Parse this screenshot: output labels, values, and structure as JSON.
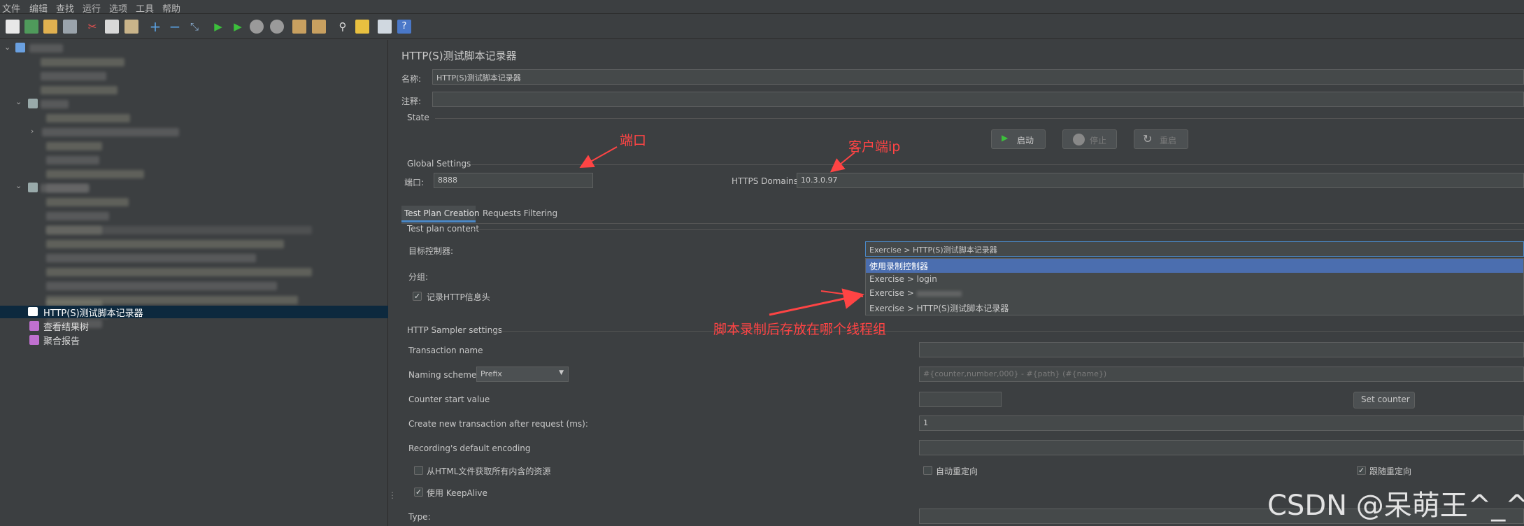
{
  "menu": [
    "文件",
    "编辑",
    "查找",
    "运行",
    "选项",
    "工具",
    "帮助"
  ],
  "toolbar_icons": [
    "new-icon",
    "templates-icon",
    "open-icon",
    "save-icon",
    "cut-icon",
    "copy-icon",
    "paste-icon",
    "expand-icon",
    "collapse-icon",
    "toggle-icon",
    "start-icon",
    "start-no-pause-icon",
    "stop-icon",
    "shutdown-icon",
    "clear-icon",
    "clear-all-icon",
    "search-icon",
    "reset-search-icon",
    "function-helper-icon",
    "help-icon"
  ],
  "tree": {
    "selected": "HTTP(S)测试脚本记录器",
    "items": [
      "查看结果树",
      "聚合报告"
    ]
  },
  "panel": {
    "title": "HTTP(S)测试脚本记录器",
    "name_label": "名称:",
    "name_value": "HTTP(S)测试脚本记录器",
    "comment_label": "注释:",
    "comment_value": "",
    "state_label": "State",
    "start_label": "启动",
    "stop_label": "停止",
    "restart_label": "重启",
    "global_label": "Global Settings",
    "port_label": "端口:",
    "port_value": "8888",
    "https_label": "HTTPS Domains:",
    "https_value": "10.3.0.97",
    "tabs": [
      "Test Plan Creation",
      "Requests Filtering"
    ],
    "test_plan_content": "Test plan content",
    "target_label": "目标控制器:",
    "target_value": "Exercise > HTTP(S)测试脚本记录器",
    "dropdown_options": [
      "使用录制控制器",
      "Exercise > login",
      "Exercise > ",
      "Exercise > HTTP(S)测试脚本记录器"
    ],
    "group_label": "分组:",
    "record_headers_label": "记录HTTP信息头",
    "sampler_settings": "HTTP Sampler settings",
    "transaction_name_label": "Transaction name",
    "transaction_name_value": "",
    "naming_scheme_label": "Naming scheme",
    "naming_scheme_value": "Prefix",
    "naming_format_placeholder": "#{counter,number,000} - #{path} (#{name})",
    "counter_start_label": "Counter start value",
    "counter_start_value": "",
    "set_counter_label": "Set counter",
    "new_transaction_label": "Create new transaction after request (ms):",
    "new_transaction_value": "1",
    "encoding_label": "Recording's default encoding",
    "encoding_value": "",
    "fetch_resources_label": "从HTML文件获取所有内含的资源",
    "auto_redirect_label": "自动重定向",
    "follow_redirect_label": "跟随重定向",
    "keepalive_label": "使用 KeepAlive",
    "type_label": "Type:"
  },
  "annotations": {
    "port": "端口",
    "client_ip": "客户端ip",
    "thread_group": "脚本录制后存放在哪个线程组"
  },
  "watermark": "CSDN @呆萌王^_^",
  "colors": {
    "accent": "#4b6eaf",
    "annotation": "#ff4444",
    "bg": "#3c3f41"
  }
}
